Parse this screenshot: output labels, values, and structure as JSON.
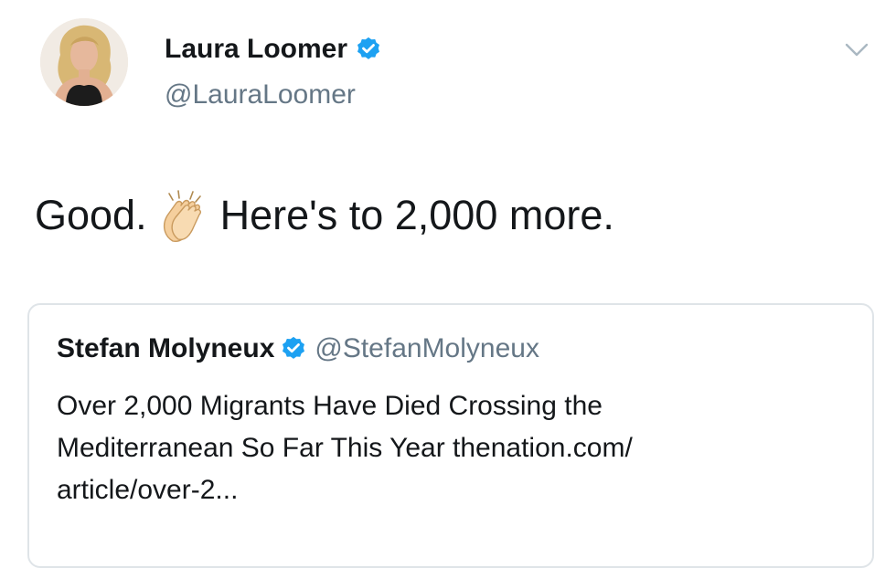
{
  "tweet": {
    "author_name": "Laura Loomer",
    "author_handle": "@LauraLoomer",
    "text_before": "Good.",
    "text_after": "Here's to 2,000 more.",
    "emoji": "clapping-hands"
  },
  "quoted_tweet": {
    "author_name": "Stefan Molyneux",
    "author_handle": "@StefanMolyneux",
    "body_lines": [
      "Over 2,000 Migrants Have Died Crossing the",
      "Mediterranean So Far This Year  thenation.com/",
      "article/over-2..."
    ]
  },
  "colors": {
    "verified_badge": "#1da1f2",
    "handle_text": "#657786",
    "primary_text": "#14171a",
    "card_border": "#dfe4e8"
  }
}
